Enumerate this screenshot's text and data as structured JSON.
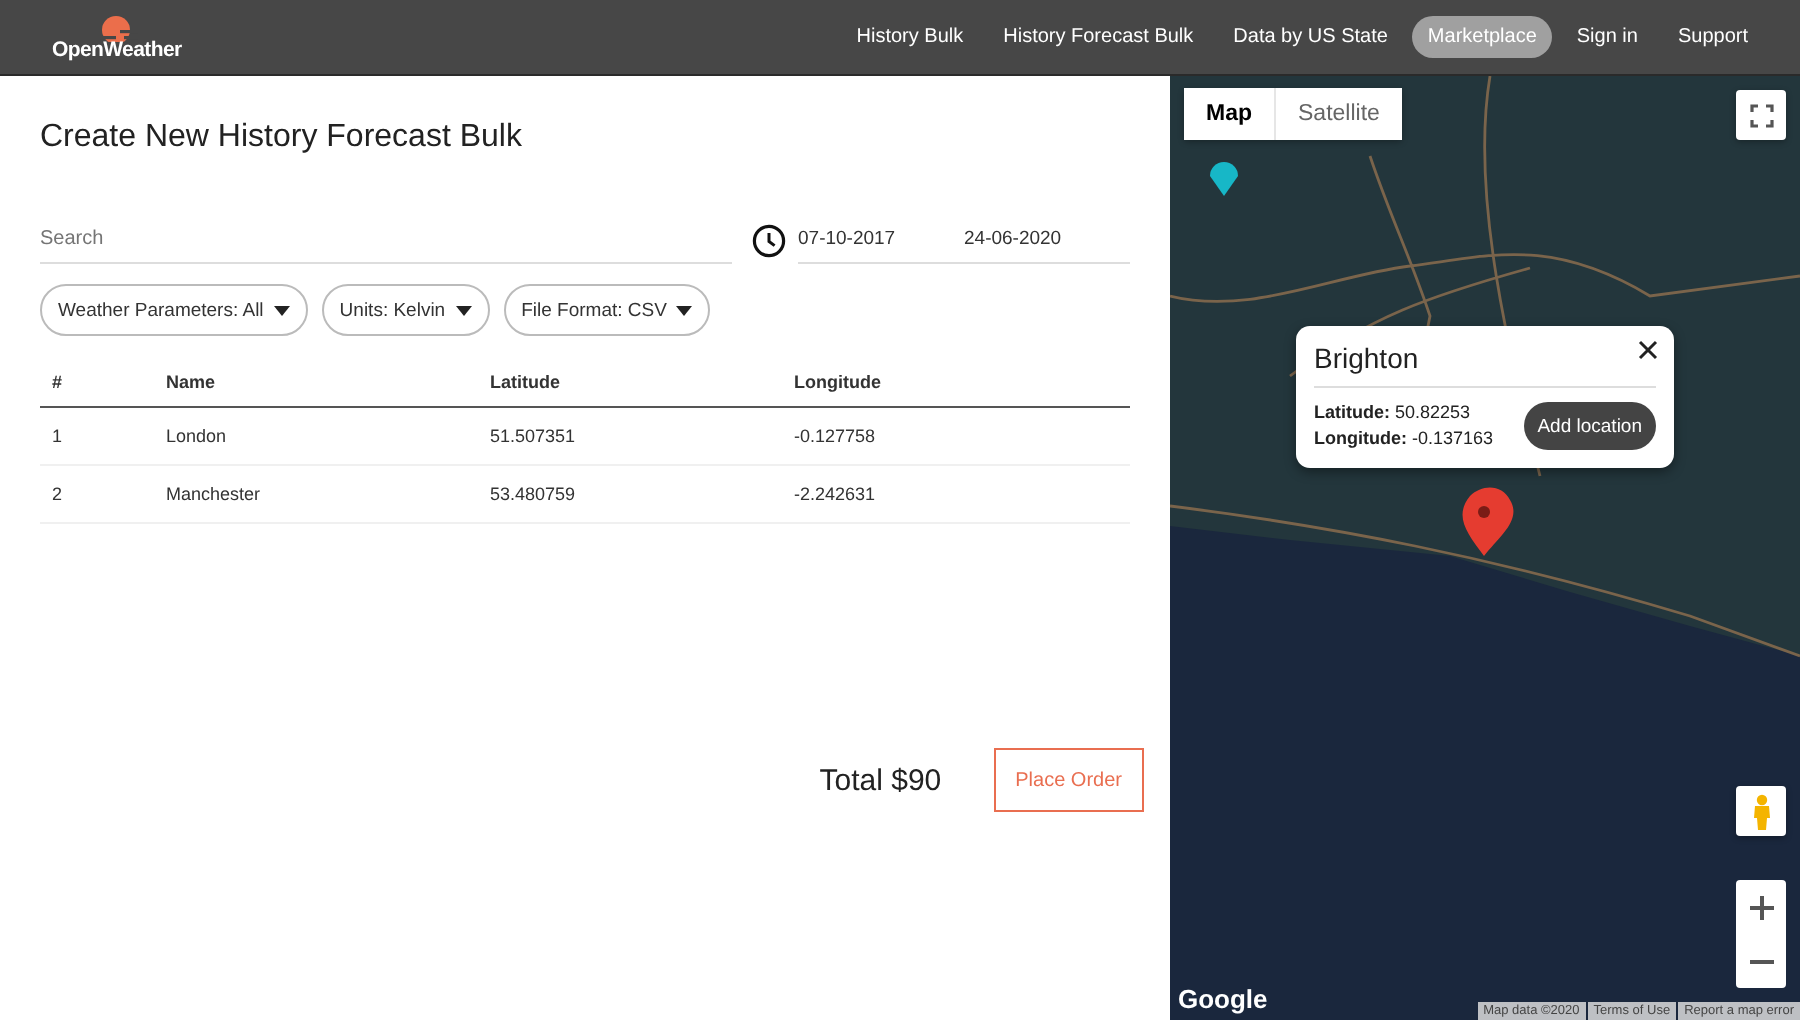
{
  "header": {
    "brand": "OpenWeather",
    "nav": [
      {
        "label": "History Bulk",
        "selected": false
      },
      {
        "label": "History Forecast Bulk",
        "selected": false
      },
      {
        "label": "Data by US State",
        "selected": false
      },
      {
        "label": "Marketplace",
        "selected": true
      },
      {
        "label": "Sign in",
        "selected": false
      },
      {
        "label": "Support",
        "selected": false
      }
    ]
  },
  "form": {
    "title": "Create New History Forecast Bulk",
    "search": {
      "placeholder": "Search"
    },
    "date_from": "07-10-2017",
    "date_to": "24-06-2020",
    "filters": [
      "Weather Parameters: All",
      "Units: Kelvin",
      "File Format: CSV"
    ],
    "table": {
      "columns": [
        "#",
        "Name",
        "Latitude",
        "Longitude"
      ],
      "rows": [
        [
          "1",
          "London",
          "51.507351",
          "-0.127758"
        ],
        [
          "2",
          "Manchester",
          "53.480759",
          "-2.242631"
        ]
      ]
    },
    "total": "Total $90",
    "order_button": "Place Order"
  },
  "map": {
    "type_tabs": [
      {
        "label": "Map",
        "selected": true
      },
      {
        "label": "Satellite",
        "selected": false
      }
    ],
    "popup": {
      "title": "Brighton",
      "fields": [
        "**Latitude:** 50.82253",
        "**Longitude:** -0.137163"
      ],
      "button": "Add location"
    },
    "logo": "Google",
    "attributions": [
      "Map data ©2020",
      "Terms of Use",
      "Report a map error"
    ]
  }
}
